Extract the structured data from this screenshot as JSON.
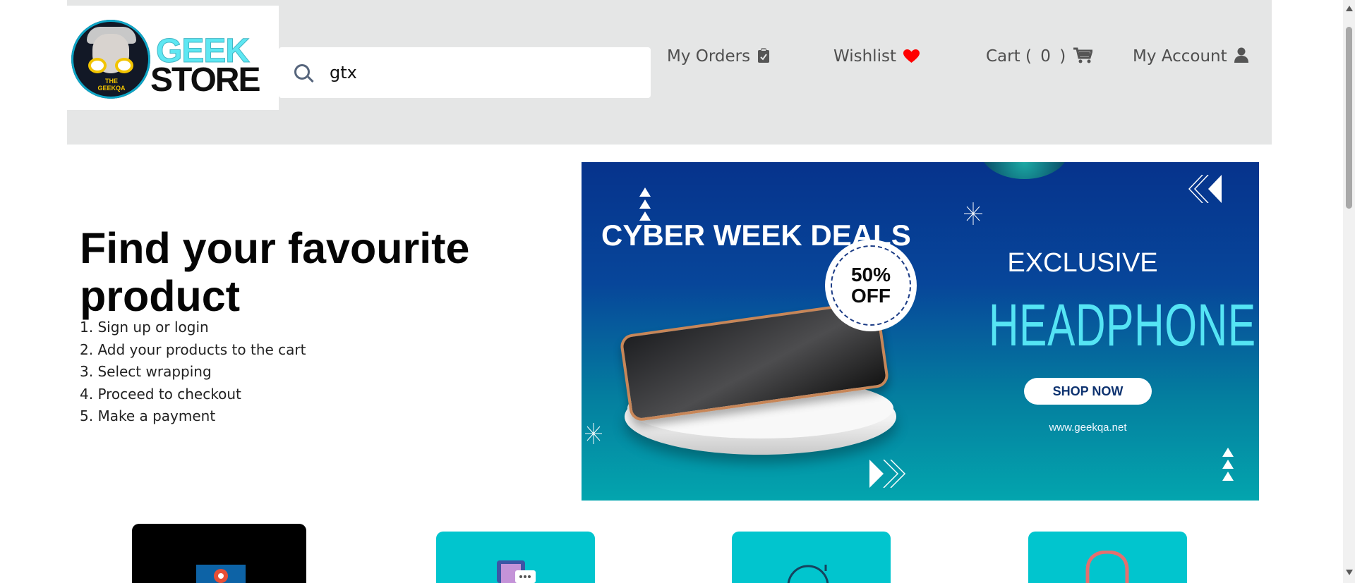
{
  "header": {
    "logo_text_top": "GEEK",
    "logo_text_bottom": "STORE",
    "logo_mark_text": "THE GEEKQA",
    "search": {
      "value": "gtx",
      "icon": "search-icon"
    },
    "nav": [
      {
        "label": "My Orders",
        "icon": "clipboard-icon"
      },
      {
        "label": "Wishlist",
        "icon": "heart-icon"
      },
      {
        "label": "Cart",
        "count": "0",
        "icon": "cart-icon"
      },
      {
        "label": "My Account",
        "icon": "user-icon"
      }
    ]
  },
  "hero": {
    "title": "Find your favourite product",
    "steps": [
      "1. Sign up or login",
      "2. Add your products to the cart",
      "3. Select wrapping",
      "4. Proceed to checkout",
      "5. Make a payment"
    ]
  },
  "banner": {
    "deals_title": "CYBER WEEK DEALS",
    "discount": "50%\nOFF",
    "exclusive": "EXCLUSIVE",
    "product": "HEADPHONE",
    "cta": "SHOP NOW",
    "website": "www.geekqa.net"
  },
  "categories": [
    {
      "icon": "monitor-icon",
      "color": "#000000"
    },
    {
      "icon": "phone-chat-icon",
      "color": "#01c5ce"
    },
    {
      "icon": "watch-icon",
      "color": "#01c5ce"
    },
    {
      "icon": "headphones-icon",
      "color": "#01c5ce"
    }
  ],
  "colors": {
    "header_bg": "#e5e6e6",
    "banner_blue": "#06338c",
    "banner_teal": "#03a5ae",
    "category_teal": "#01c5ce",
    "wishlist_heart": "#ff0000"
  }
}
